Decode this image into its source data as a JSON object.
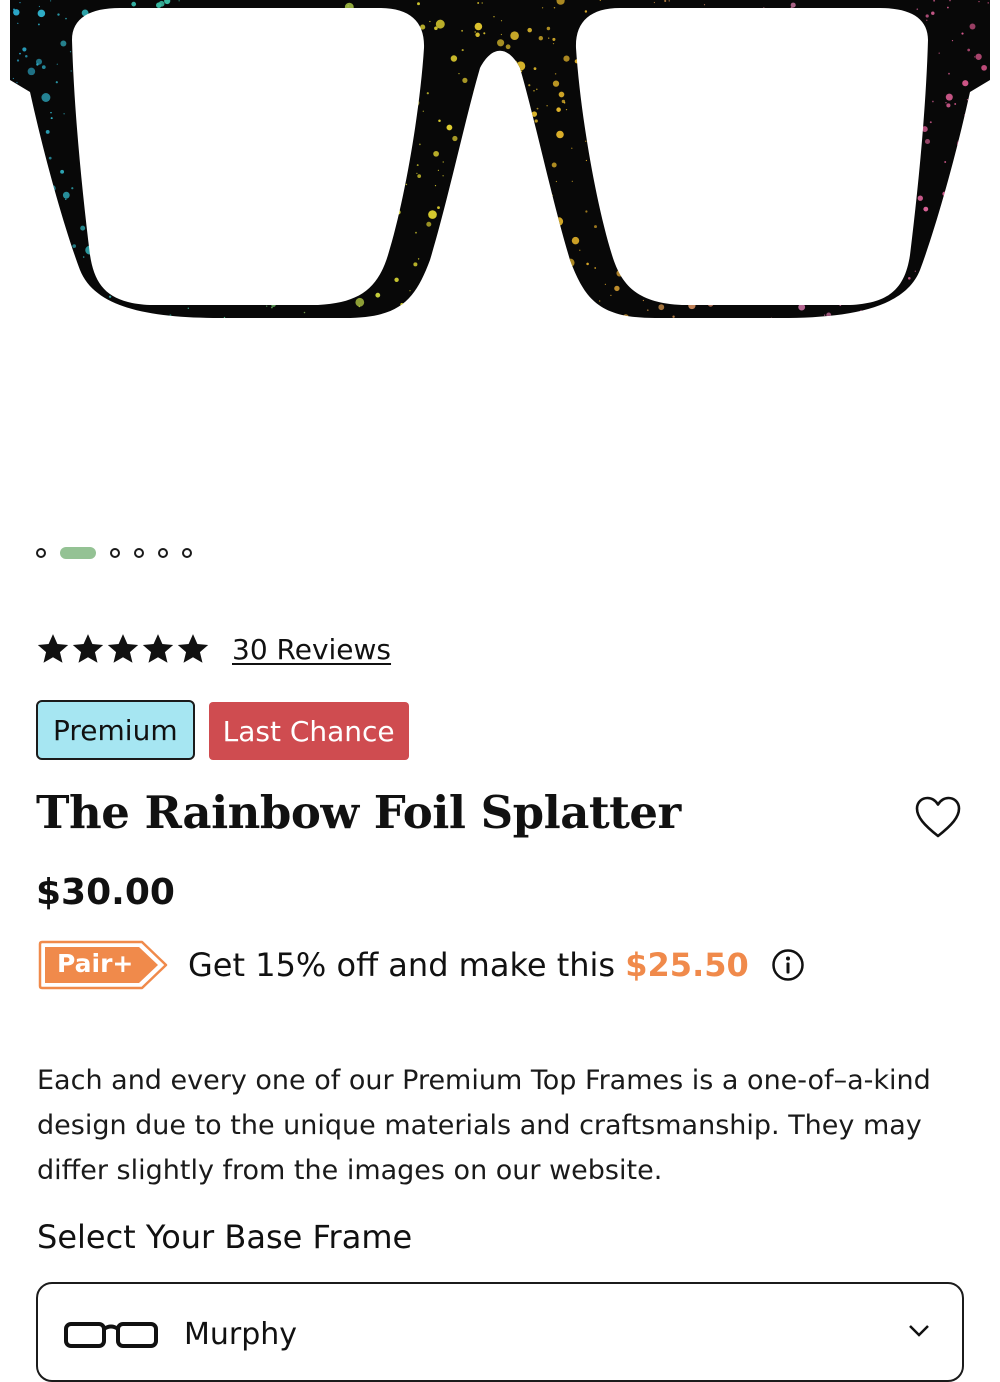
{
  "gallery": {
    "image": "rainbow-foil-splatter-glasses",
    "slide_count": 6,
    "active_slide": 2
  },
  "rating": {
    "stars": 5,
    "reviews_label": "30 Reviews"
  },
  "badges": [
    {
      "label": "Premium",
      "color": "#a6e6f2"
    },
    {
      "label": "Last Chance",
      "color": "#cf4c50"
    }
  ],
  "product": {
    "title": "The Rainbow Foil Splatter",
    "price": "$30.00"
  },
  "pair_plus": {
    "tag_label": "Pair+",
    "tag_color": "#f08a4b",
    "text": "Get 15% off and make this ",
    "discount_price": "$25.50",
    "info_icon": "info-icon"
  },
  "description": "Each and every one of our Premium Top Frames is a one-of–a-kind design due to the unique materials and craftsmanship. They may differ slightly from the images on our website.",
  "base_frame": {
    "heading": "Select Your Base Frame",
    "selected": "Murphy"
  },
  "icons": {
    "favorite": "heart-outline-icon",
    "frame": "glasses-outline-icon",
    "expand": "chevron-down-icon"
  }
}
